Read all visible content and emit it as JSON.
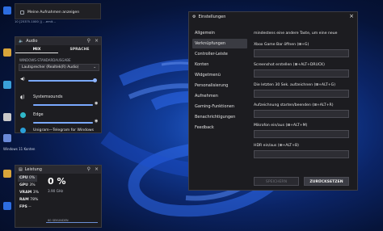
{
  "gallery": {
    "show_captures_label": "Meine Aufnahmen anzeigen"
  },
  "desktop": {
    "path_strip": "10 [253?5.1000 ]| ...emit...",
    "icon_label": "Windows 11 Konten"
  },
  "audio": {
    "title": "Audio",
    "tabs": [
      "MIX",
      "SPRACHE"
    ],
    "default_output_heading": "WINDOWS-STANDARDAUSGABE",
    "output_device": "Lautsprecher (Realtek(R) Audio)",
    "apps": [
      {
        "name": "Systemsounds"
      },
      {
        "name": "Edge"
      },
      {
        "name": "Unigram—Telegram for Windows"
      }
    ]
  },
  "performance": {
    "title": "Leistung",
    "cpu_label": "CPU",
    "cpu_value": "0%",
    "big_value": "0 %",
    "gpu_label": "GPU",
    "gpu_value": "3%",
    "vram_label": "VRAM",
    "vram_value": "3%",
    "ram_label": "RAM",
    "ram_value": "78%",
    "fps_label": "FPS",
    "fps_value": "--",
    "freq": "3.90 GHz",
    "footer": "60 SEKUNDEN"
  },
  "settings": {
    "title": "Einstellungen",
    "nav": [
      "Allgemein",
      "Verknüpfungen",
      "Controller-Leiste",
      "Konten",
      "Widgetmenü",
      "Personalisierung",
      "Aufnehmen",
      "Gaming-Funktionen",
      "Benachrichtigungen",
      "Feedback"
    ],
    "note": "mindestens eine andere Taste, um eine neue",
    "fields": [
      {
        "label": "Xbox Game Bar öffnen (⊞+G)",
        "value": ""
      },
      {
        "label": "Screenshot erstellen (⊞+ALT+DRUCK)",
        "value": ""
      },
      {
        "label": "Die letzten 30 Sek. aufzeichnen (⊞+ALT+G)",
        "value": ""
      },
      {
        "label": "Aufzeichnung starten/beenden (⊞+ALT+R)",
        "value": ""
      },
      {
        "label": "Mikrofon ein/aus (⊞+ALT+M)",
        "value": ""
      },
      {
        "label": "HDR ein/aus (⊞+ALT+B)",
        "value": ""
      }
    ],
    "save_label": "SPEICHERN",
    "reset_label": "ZURÜCKSETZEN"
  },
  "colors": {
    "accent": "#7aa9ff",
    "wallpaper": "#1b4fc4"
  }
}
